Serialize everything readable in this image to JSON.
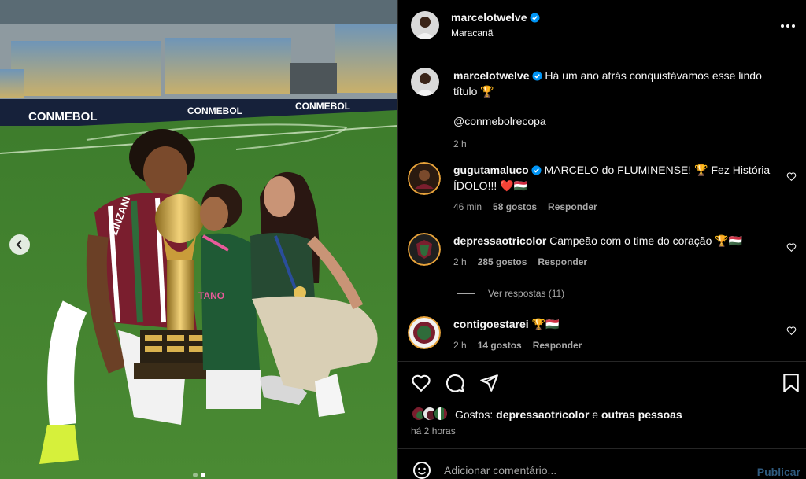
{
  "post_header": {
    "username": "marcelotwelve",
    "verified": true,
    "location": "Maracanã"
  },
  "photo": {
    "banner_text": "CONMEBOL",
    "jersey_text": "ZINZANI",
    "jersey_text_2": "TANO",
    "carousel_dots": 2,
    "active_dot": 1
  },
  "caption": {
    "username": "marcelotwelve",
    "line1": "Há um ano atrás conquistávamos esse lindo",
    "line2": "título 🏆",
    "mention": "@conmebolrecopa",
    "time": "2 h"
  },
  "comments": [
    {
      "username": "gugutamaluco",
      "verified": true,
      "text": "MARCELO do FLUMINENSE! 🏆 Fez História",
      "text2": "ÍDOLO!!! ❤️🇭🇺",
      "time": "46 min",
      "likes": "58 gostos",
      "reply": "Responder"
    },
    {
      "username": "depressaotricolor",
      "verified": false,
      "text": "Campeão com o time do coração 🏆🇭🇺",
      "time": "2 h",
      "likes": "285 gostos",
      "reply": "Responder"
    },
    {
      "username": "contigoestarei",
      "verified": false,
      "text": "🏆🇭🇺",
      "time": "2 h",
      "likes": "14 gostos",
      "reply": "Responder"
    }
  ],
  "view_replies": "Ver respostas (11)",
  "likes_summary": {
    "prefix": "Gostos:",
    "user": "depressaotricolor",
    "joiner": "e",
    "others": "outras pessoas"
  },
  "posted_ago": "há 2 horas",
  "add_comment": {
    "placeholder": "Adicionar comentário...",
    "publish_label": "Publicar"
  },
  "colors": {
    "background": "#000000",
    "verified_blue": "#0095f6",
    "publish_disabled": "#2f5a7e",
    "pitch_green": "#3f7a2f",
    "maroon": "#7a1e2e"
  }
}
